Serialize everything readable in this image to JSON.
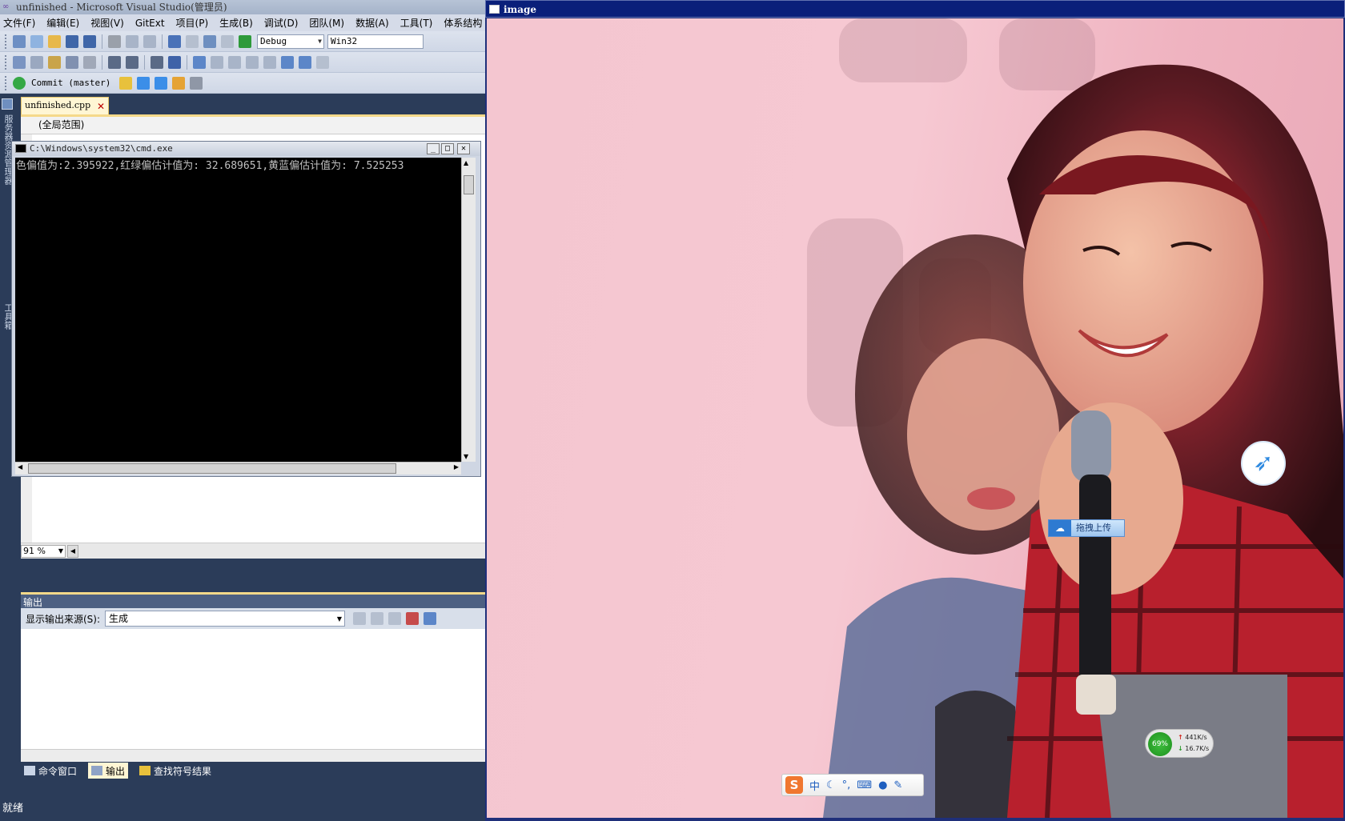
{
  "vs": {
    "title": "unfinished - Microsoft Visual Studio(管理员)",
    "menu": [
      "文件(F)",
      "编辑(E)",
      "视图(V)",
      "GitExt",
      "项目(P)",
      "生成(B)",
      "调试(D)",
      "团队(M)",
      "数据(A)",
      "工具(T)",
      "体系结构"
    ],
    "toolbar": {
      "config": "Debug",
      "platform": "Win32",
      "commit_label": "Commit (master)"
    },
    "side_labels": [
      "服务器资源管理器",
      "工具箱"
    ],
    "doc_tab": "unfinished.cpp",
    "scope": "(全局范围)",
    "zoom": "91 %",
    "output": {
      "header": "输出",
      "source_label": "显示输出来源(S):",
      "source_value": "生成"
    },
    "bottom_tabs": [
      "命令窗口",
      "输出",
      "查找符号结果"
    ],
    "status": "就绪"
  },
  "cmd": {
    "title": "C:\\Windows\\system32\\cmd.exe",
    "output_line": "色偏值为:2.395922,红绿偏估计值为: 32.689651,黄蓝偏估计值为: 7.525253"
  },
  "image_window": {
    "title": "image",
    "overlays": {
      "upload_label": "拖拽上传",
      "net_percent": "69%",
      "net_up": "441K/s",
      "net_down": "16.7K/s",
      "ime_logo": "S",
      "ime_mode": "中"
    }
  }
}
